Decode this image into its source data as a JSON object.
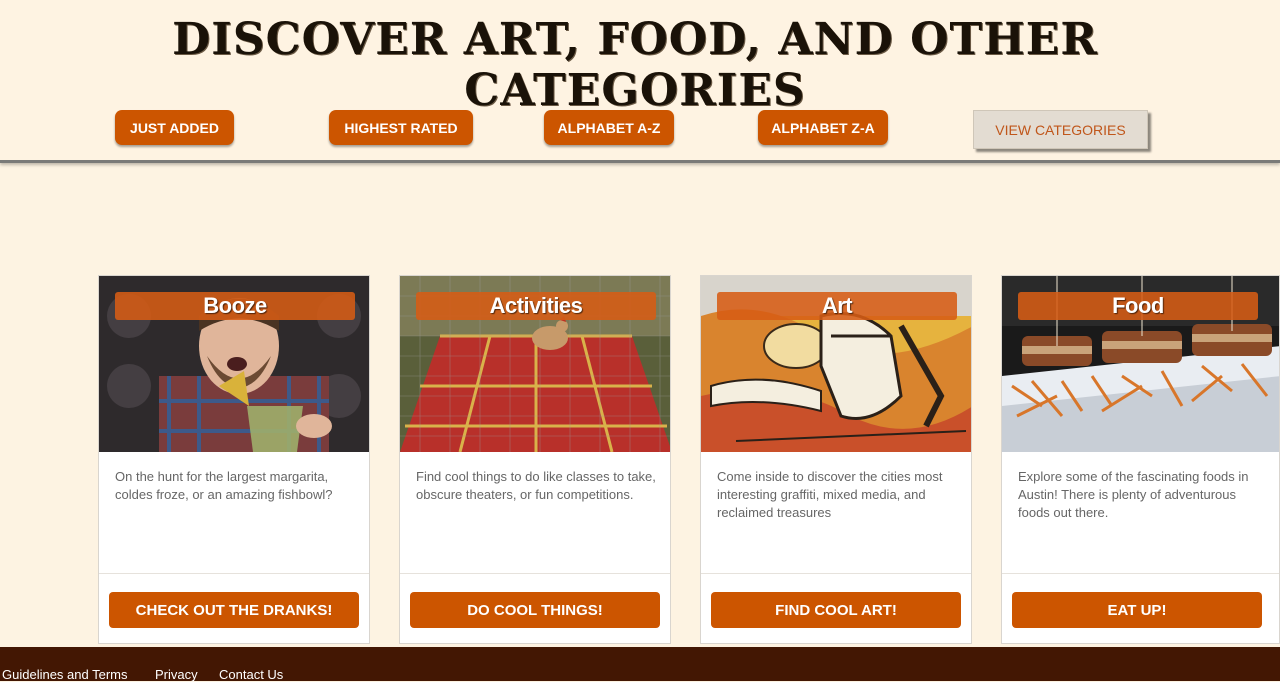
{
  "page": {
    "title": "DISCOVER ART, FOOD, AND OTHER CATEGORIES",
    "accent_color": "#cc5500",
    "background_color": "#fdf3e2",
    "footer_color": "#431703"
  },
  "sort_buttons": [
    {
      "label": "JUST ADDED"
    },
    {
      "label": "HIGHEST RATED"
    },
    {
      "label": "ALPHABET A-Z"
    },
    {
      "label": "ALPHABET Z-A"
    }
  ],
  "view_categories": {
    "label": "VIEW CATEGORIES"
  },
  "cards": [
    {
      "title": "Booze",
      "description": "On the hunt for the largest margarita, coldes froze, or an amazing fishbowl?",
      "button": "CHECK OUT THE DRANKS!",
      "image": "man-drinking-cocktail-photo"
    },
    {
      "title": "Activities",
      "description": "Find cool things to do like classes to take, obscure theaters, or fun competitions.",
      "button": "DO COOL THINGS!",
      "image": "chicken-bingo-board-photo"
    },
    {
      "title": "Art",
      "description": "Come inside to discover the cities most interesting graffiti, mixed media, and reclaimed treasures",
      "button": "FIND COOL ART!",
      "image": "keep-austin-weird-mural-photo"
    },
    {
      "title": "Food",
      "description": "Explore some of the fascinating foods in Austin! There is plenty of adventurous foods out there.",
      "button": "EAT UP!",
      "image": "sandwiches-and-fries-photo"
    }
  ],
  "footer": {
    "links": [
      {
        "label": "Guidelines and Terms"
      },
      {
        "label": "Privacy"
      },
      {
        "label": "Contact Us"
      }
    ]
  }
}
